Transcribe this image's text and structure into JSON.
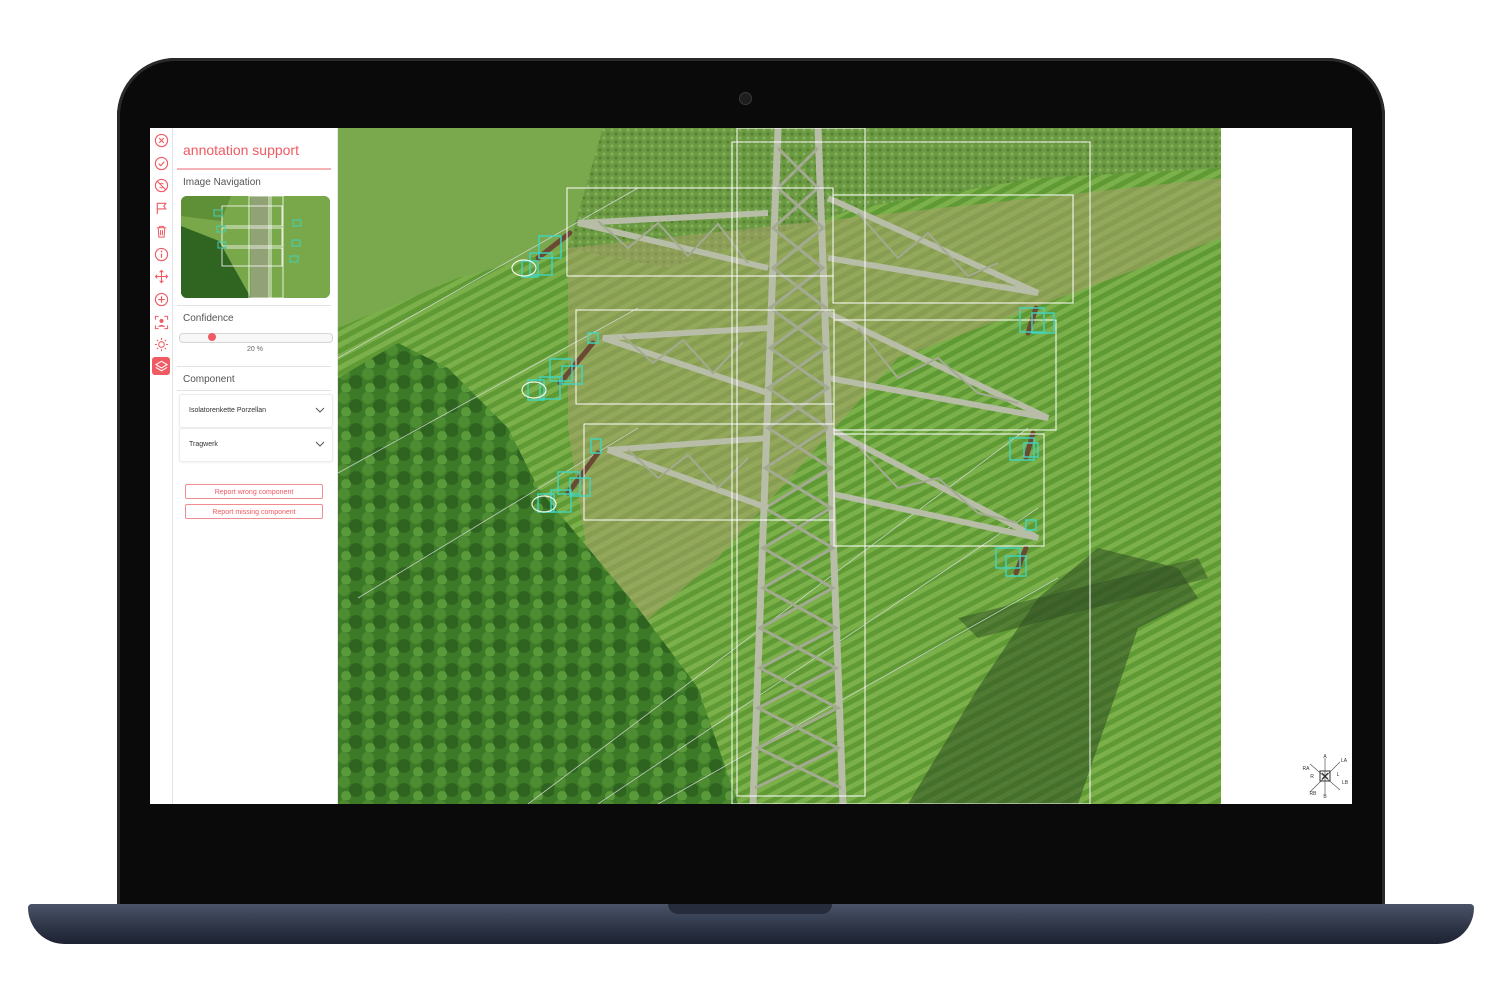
{
  "app": {
    "title": "annotation support"
  },
  "toolbar": {
    "tools": [
      {
        "icon": "close-circle-icon"
      },
      {
        "icon": "check-circle-icon"
      },
      {
        "icon": "no-entry-icon"
      },
      {
        "icon": "flag-icon"
      },
      {
        "icon": "trash-icon"
      },
      {
        "icon": "info-icon"
      },
      {
        "icon": "move-icon"
      },
      {
        "icon": "add-circle-icon"
      },
      {
        "icon": "focus-person-icon"
      },
      {
        "icon": "brightness-icon"
      },
      {
        "icon": "layers-icon",
        "active": true
      }
    ],
    "accent_color": "#ef5a63"
  },
  "panel": {
    "image_navigation_label": "Image Navigation",
    "confidence_label": "Confidence",
    "confidence_value": "20 %",
    "confidence_fraction": 0.2,
    "component_label": "Component",
    "components": [
      {
        "label": "Isolatorenkette Porzellan"
      },
      {
        "label": "Tragwerk"
      }
    ],
    "report_wrong_label": "Report wrong component",
    "report_missing_label": "Report missing component"
  },
  "viewer": {
    "annotation_colors": {
      "insulator": "#3fd6c2",
      "structure": "#ffffff"
    }
  },
  "compass": {
    "labels": [
      "A",
      "LA",
      "L",
      "LB",
      "B",
      "RB",
      "R",
      "RA"
    ]
  }
}
